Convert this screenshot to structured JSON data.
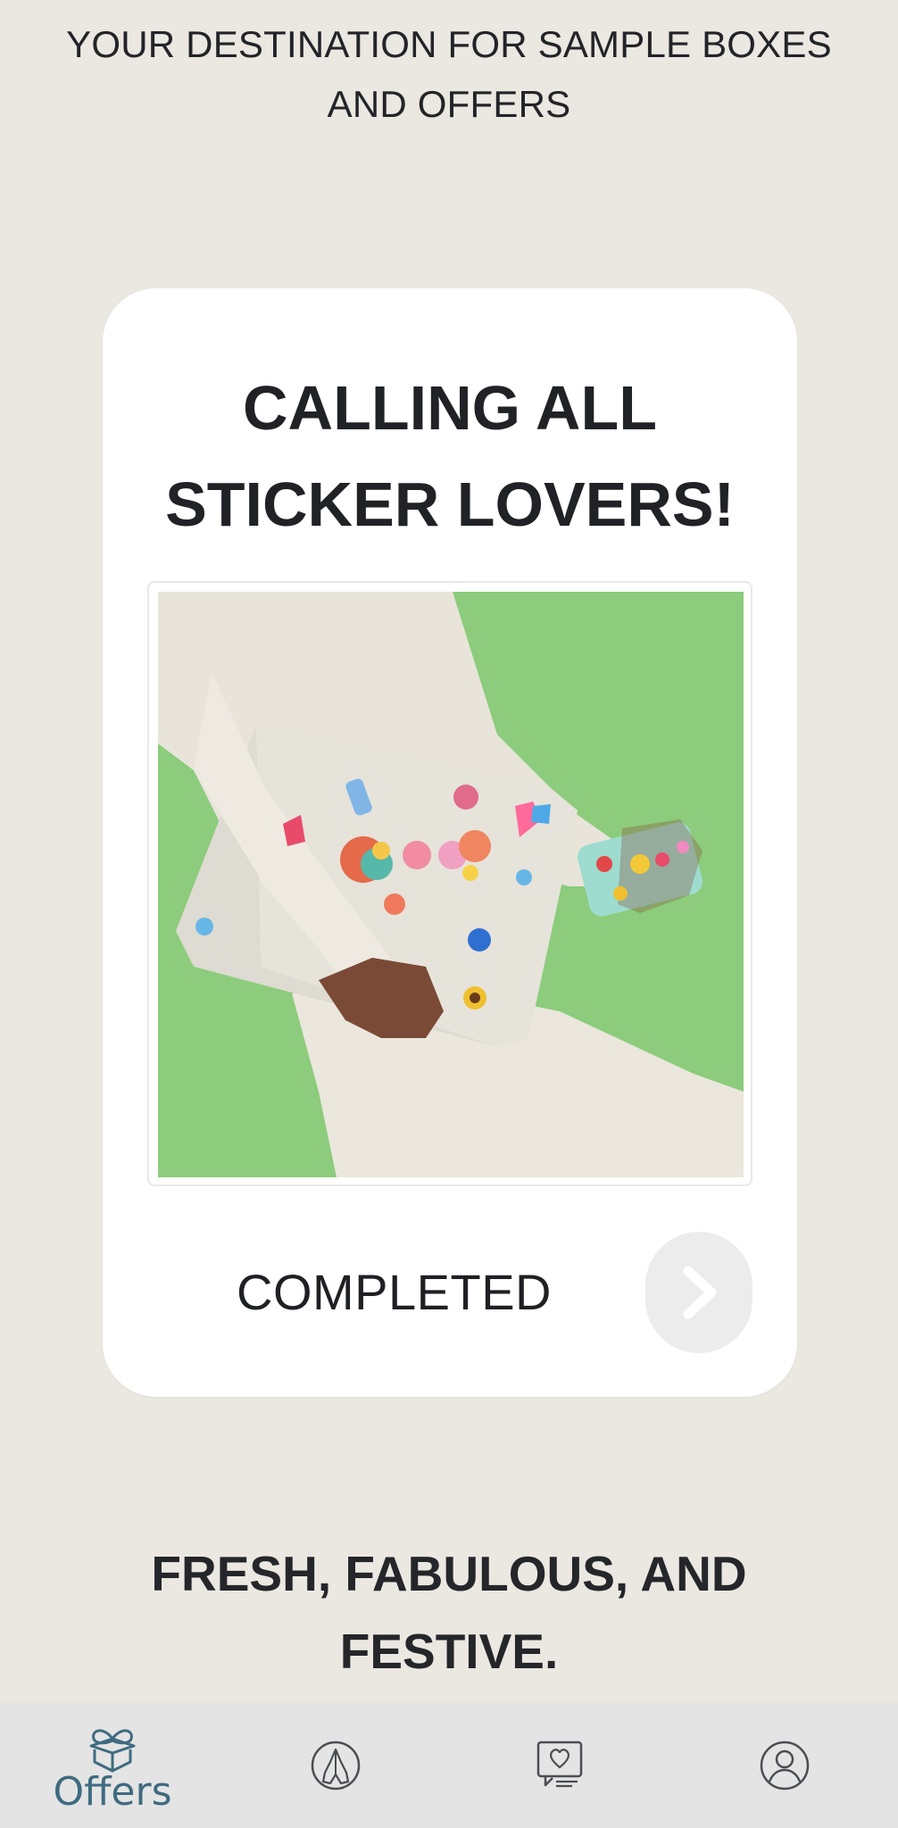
{
  "header": {
    "tagline": "YOUR DESTINATION FOR SAMPLE BOXES AND OFFERS"
  },
  "offer_card": {
    "title": "CALLING ALL STICKER LOVERS!",
    "status": "COMPLETED",
    "next_icon": "chevron-right-icon"
  },
  "section": {
    "heading": "FRESH, FABULOUS, AND FESTIVE."
  },
  "bottom_nav": {
    "items": [
      {
        "label": "Offers",
        "icon": "gift-box-icon",
        "active": true
      },
      {
        "label": "",
        "icon": "praying-hands-icon",
        "active": false
      },
      {
        "label": "",
        "icon": "heart-screen-icon",
        "active": false
      },
      {
        "label": "",
        "icon": "profile-icon",
        "active": false
      }
    ]
  },
  "colors": {
    "background": "#ebe7e1",
    "card": "#ffffff",
    "nav_background": "#e4e4e4",
    "nav_active": "#3e6b80",
    "photo_green": "#8ccc7c"
  }
}
